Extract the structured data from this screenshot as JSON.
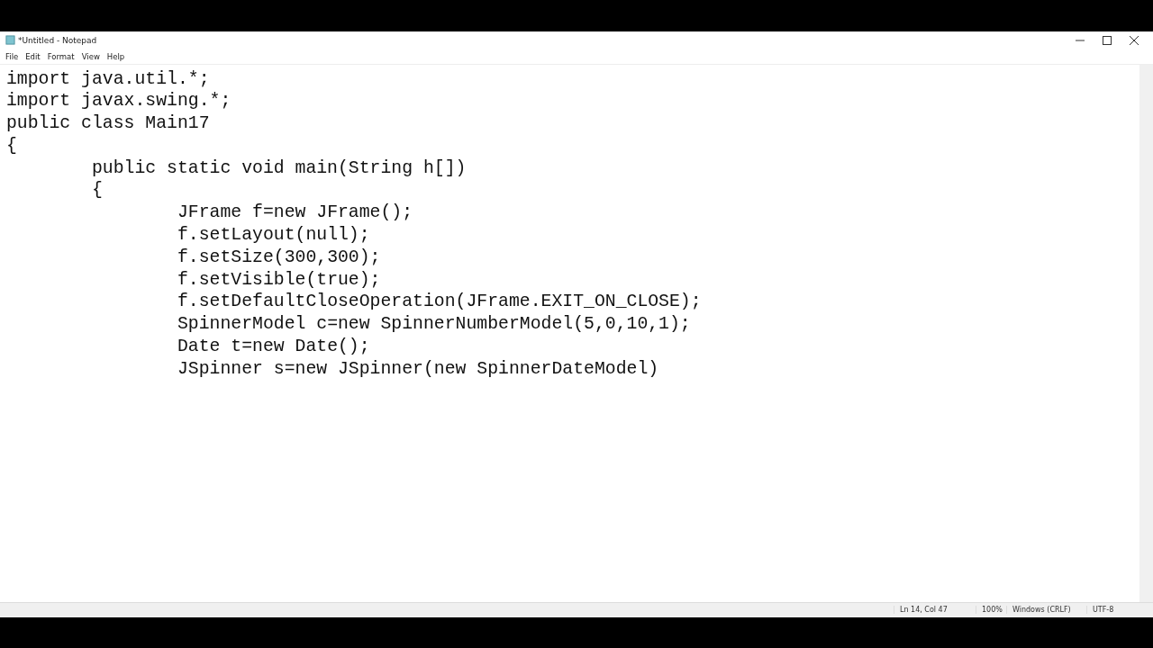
{
  "window": {
    "title": "*Untitled - Notepad"
  },
  "menu": [
    "File",
    "Edit",
    "Format",
    "View",
    "Help"
  ],
  "editor": {
    "lines": [
      "import java.util.*;",
      "import javax.swing.*;",
      "public class Main17",
      "{",
      "\tpublic static void main(String h[])",
      "\t{",
      "\t\tJFrame f=new JFrame();",
      "\t\tf.setLayout(null);",
      "\t\tf.setSize(300,300);",
      "\t\tf.setVisible(true);",
      "\t\tf.setDefaultCloseOperation(JFrame.EXIT_ON_CLOSE);",
      "\t\tSpinnerModel c=new SpinnerNumberModel(5,0,10,1);",
      "\t\tDate t=new Date();",
      "\t\tJSpinner s=new JSpinner(new SpinnerDateModel)"
    ]
  },
  "status_bar": [
    "Ln 14, Col 47",
    "100%",
    "Windows (CRLF)",
    "UTF-8"
  ]
}
